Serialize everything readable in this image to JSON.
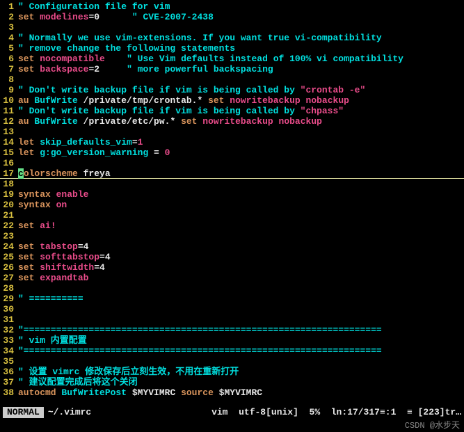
{
  "lines": [
    {
      "n": "1",
      "tokens": [
        {
          "t": "\" Configuration file for vim",
          "c": "comment"
        }
      ]
    },
    {
      "n": "2",
      "tokens": [
        {
          "t": "set",
          "c": "keyword"
        },
        {
          "t": " ",
          "c": "plain"
        },
        {
          "t": "modelines",
          "c": "option"
        },
        {
          "t": "=0",
          "c": "plain"
        },
        {
          "t": "      ",
          "c": "plain"
        },
        {
          "t": "\" CVE-2007-2438",
          "c": "comment"
        }
      ]
    },
    {
      "n": "3",
      "tokens": []
    },
    {
      "n": "4",
      "tokens": [
        {
          "t": "\" Normally we use vim-extensions. If you want true vi-compatibility",
          "c": "comment"
        }
      ]
    },
    {
      "n": "5",
      "tokens": [
        {
          "t": "\" remove change the following statements",
          "c": "comment"
        }
      ]
    },
    {
      "n": "6",
      "tokens": [
        {
          "t": "set",
          "c": "keyword"
        },
        {
          "t": " ",
          "c": "plain"
        },
        {
          "t": "nocompatible",
          "c": "option"
        },
        {
          "t": "    ",
          "c": "plain"
        },
        {
          "t": "\" Use Vim defaults instead of 100% vi compatibility",
          "c": "comment"
        }
      ]
    },
    {
      "n": "7",
      "tokens": [
        {
          "t": "set",
          "c": "keyword"
        },
        {
          "t": " ",
          "c": "plain"
        },
        {
          "t": "backspace",
          "c": "option"
        },
        {
          "t": "=2",
          "c": "plain"
        },
        {
          "t": "     ",
          "c": "plain"
        },
        {
          "t": "\" more powerful backspacing",
          "c": "comment"
        }
      ]
    },
    {
      "n": "8",
      "tokens": []
    },
    {
      "n": "9",
      "tokens": [
        {
          "t": "\" Don't write backup file if vim is being called by ",
          "c": "comment"
        },
        {
          "t": "\"crontab -e\"",
          "c": "string"
        }
      ]
    },
    {
      "n": "10",
      "tokens": [
        {
          "t": "au",
          "c": "keyword"
        },
        {
          "t": " ",
          "c": "plain"
        },
        {
          "t": "BufWrite",
          "c": "identifier"
        },
        {
          "t": " /private/tmp/crontab.* ",
          "c": "plain"
        },
        {
          "t": "set",
          "c": "keyword"
        },
        {
          "t": " ",
          "c": "plain"
        },
        {
          "t": "nowritebackup",
          "c": "option"
        },
        {
          "t": " ",
          "c": "plain"
        },
        {
          "t": "nobackup",
          "c": "option"
        }
      ]
    },
    {
      "n": "11",
      "tokens": [
        {
          "t": "\" Don't write backup file if vim is being called by ",
          "c": "comment"
        },
        {
          "t": "\"chpass\"",
          "c": "string"
        }
      ]
    },
    {
      "n": "12",
      "tokens": [
        {
          "t": "au",
          "c": "keyword"
        },
        {
          "t": " ",
          "c": "plain"
        },
        {
          "t": "BufWrite",
          "c": "identifier"
        },
        {
          "t": " /private/etc/pw.* ",
          "c": "plain"
        },
        {
          "t": "set",
          "c": "keyword"
        },
        {
          "t": " ",
          "c": "plain"
        },
        {
          "t": "nowritebackup",
          "c": "option"
        },
        {
          "t": " ",
          "c": "plain"
        },
        {
          "t": "nobackup",
          "c": "option"
        }
      ]
    },
    {
      "n": "13",
      "tokens": []
    },
    {
      "n": "14",
      "tokens": [
        {
          "t": "let",
          "c": "keyword"
        },
        {
          "t": " ",
          "c": "plain"
        },
        {
          "t": "skip_defaults_vim",
          "c": "identifier"
        },
        {
          "t": "=",
          "c": "plain"
        },
        {
          "t": "1",
          "c": "number"
        }
      ]
    },
    {
      "n": "15",
      "tokens": [
        {
          "t": "let",
          "c": "keyword"
        },
        {
          "t": " ",
          "c": "plain"
        },
        {
          "t": "g:go_version_warning",
          "c": "identifier"
        },
        {
          "t": " = ",
          "c": "plain"
        },
        {
          "t": "0",
          "c": "number"
        }
      ]
    },
    {
      "n": "16",
      "tokens": []
    },
    {
      "n": "17",
      "cursor": true,
      "tokens": [
        {
          "t": "c",
          "c": "cursor"
        },
        {
          "t": "olorscheme",
          "c": "keyword"
        },
        {
          "t": " freya",
          "c": "literal"
        }
      ]
    },
    {
      "n": "18",
      "tokens": []
    },
    {
      "n": "19",
      "tokens": [
        {
          "t": "syntax",
          "c": "keyword"
        },
        {
          "t": " ",
          "c": "plain"
        },
        {
          "t": "enable",
          "c": "option"
        }
      ]
    },
    {
      "n": "20",
      "tokens": [
        {
          "t": "syntax",
          "c": "keyword"
        },
        {
          "t": " ",
          "c": "plain"
        },
        {
          "t": "on",
          "c": "option"
        }
      ]
    },
    {
      "n": "21",
      "tokens": []
    },
    {
      "n": "22",
      "tokens": [
        {
          "t": "set",
          "c": "keyword"
        },
        {
          "t": " ",
          "c": "plain"
        },
        {
          "t": "ai!",
          "c": "option"
        }
      ]
    },
    {
      "n": "23",
      "tokens": []
    },
    {
      "n": "24",
      "tokens": [
        {
          "t": "set",
          "c": "keyword"
        },
        {
          "t": " ",
          "c": "plain"
        },
        {
          "t": "tabstop",
          "c": "option"
        },
        {
          "t": "=4",
          "c": "plain"
        }
      ]
    },
    {
      "n": "25",
      "tokens": [
        {
          "t": "set",
          "c": "keyword"
        },
        {
          "t": " ",
          "c": "plain"
        },
        {
          "t": "softtabstop",
          "c": "option"
        },
        {
          "t": "=4",
          "c": "plain"
        }
      ]
    },
    {
      "n": "26",
      "tokens": [
        {
          "t": "set",
          "c": "keyword"
        },
        {
          "t": " ",
          "c": "plain"
        },
        {
          "t": "shiftwidth",
          "c": "option"
        },
        {
          "t": "=4",
          "c": "plain"
        }
      ]
    },
    {
      "n": "27",
      "tokens": [
        {
          "t": "set",
          "c": "keyword"
        },
        {
          "t": " ",
          "c": "plain"
        },
        {
          "t": "expandtab",
          "c": "option"
        }
      ]
    },
    {
      "n": "28",
      "tokens": []
    },
    {
      "n": "29",
      "tokens": [
        {
          "t": "\" ==========",
          "c": "comment"
        }
      ]
    },
    {
      "n": "30",
      "tokens": []
    },
    {
      "n": "31",
      "tokens": []
    },
    {
      "n": "32",
      "tokens": [
        {
          "t": "\"==================================================================",
          "c": "comment"
        }
      ]
    },
    {
      "n": "33",
      "tokens": [
        {
          "t": "\" vim 内置配置",
          "c": "comment"
        }
      ]
    },
    {
      "n": "34",
      "tokens": [
        {
          "t": "\"==================================================================",
          "c": "comment"
        }
      ]
    },
    {
      "n": "35",
      "tokens": []
    },
    {
      "n": "36",
      "tokens": [
        {
          "t": "\" 设置 vimrc 修改保存后立刻生效，不用在重新打开",
          "c": "comment"
        }
      ]
    },
    {
      "n": "37",
      "tokens": [
        {
          "t": "\" 建议配置完成后将这个关闭",
          "c": "comment"
        }
      ]
    },
    {
      "n": "38",
      "tokens": [
        {
          "t": "autocmd",
          "c": "keyword"
        },
        {
          "t": " ",
          "c": "plain"
        },
        {
          "t": "BufWritePost",
          "c": "identifier"
        },
        {
          "t": " $MYVIMRC ",
          "c": "plain"
        },
        {
          "t": "source",
          "c": "keyword"
        },
        {
          "t": " $MYVIMRC",
          "c": "plain"
        }
      ]
    }
  ],
  "statusbar": {
    "mode": "NORMAL",
    "file": "~/.vimrc",
    "ft": "vim",
    "enc": "utf-8[unix]",
    "percent": "5%",
    "pos": "ln:17/317≡:1",
    "extra": "≡ [223]tr…"
  },
  "watermark": "CSDN @水步天"
}
